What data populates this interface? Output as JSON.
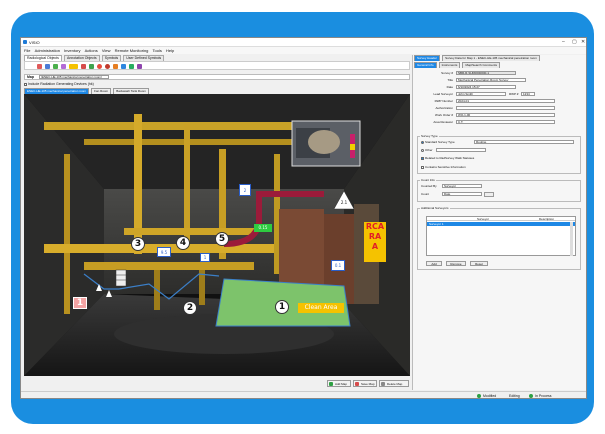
{
  "window": {
    "title": "VISIO",
    "controls": [
      "–",
      "▢",
      "✕"
    ]
  },
  "menu": [
    "File",
    "Administration",
    "Inventory",
    "Actions",
    "View",
    "Remote Monitoring",
    "Tools",
    "Help"
  ],
  "toolbar_tabs": [
    "Radiological Objects",
    "Annotation Objects",
    "Symbols",
    "User Defined Symbols"
  ],
  "map": {
    "label": "Map",
    "value": "(ENEC-HE-105 mechanical penetration room)",
    "checkbox_label": "Include Radiation Generating Devices (hk)",
    "tabs": [
      "ENEC-HE-105 mechanical penetration room",
      "Fan Room",
      "Backwash Tank Room"
    ],
    "labels": {
      "n1": "1",
      "n2": "2",
      "n3": "3",
      "n4": "4",
      "n5": "5",
      "box1": "1",
      "clean_area": "Clean Area",
      "rca": "RCA",
      "ra": "RA",
      "a": "A",
      "green_tag": "0.15",
      "tri": "2.1",
      "v1": "2",
      "v2": "9.5",
      "v3": "0.1",
      "v4": "1"
    }
  },
  "bottom_buttons": [
    "Add Map",
    "Save Map",
    "Delete Map"
  ],
  "status": {
    "modified": "Modified",
    "editing": "Editing",
    "in_process": "In Process"
  },
  "right": {
    "tabs": [
      "Survey Header",
      "Survey Data for Map 1 - ENEC-HE-105 mechanical penetration room"
    ],
    "subtabs": [
      "General Info",
      "Instruments",
      "Map/Search Comments"
    ],
    "fields": {
      "survey_label": "Survey #",
      "survey_val": "SBR-R-SUR0000000-1",
      "title_label": "Title",
      "title_val": "Mechanical Penetration Room Survey",
      "date_label": "Date",
      "date_val": "6/10/2024 15:27",
      "lead_label": "Lead Surveyor",
      "lead_val": "John Smith",
      "rwp_label": "RWP Number",
      "rwp_val": "2024-01",
      "rwp_rev_label": "RWP #",
      "rwp_rev_val": "1234",
      "auth_label": "Authorization",
      "auth_val": "",
      "work_label": "Work Order #",
      "work_val": "WO-1-00",
      "area_label": "Area Reviewer",
      "area_val": "C.T."
    },
    "survey_type": {
      "title": "Survey Type",
      "standard": "Standard Survey Type",
      "standard_select": "Routine",
      "other": "Other",
      "related": "Related to RadSurvey Walk Statuses",
      "contains": "Contains Sensitive Information"
    },
    "count": {
      "title": "Count Info",
      "counted_by_label": "Counted By",
      "counted_by_val": "Surveyor",
      "count_label": "Count",
      "count_val": "Date"
    },
    "additional": {
      "title": "Additional Surveyors",
      "col1": "Surveyor",
      "col2": "Description",
      "row1": "Surveyor 1",
      "add": "Add",
      "remove": "Remove",
      "reset": "Reset"
    }
  },
  "colors": {
    "frame": "#1a8ee0",
    "accent": "#1e88e5",
    "clean_area": "#7dc36b",
    "rca": "#f5c200"
  }
}
